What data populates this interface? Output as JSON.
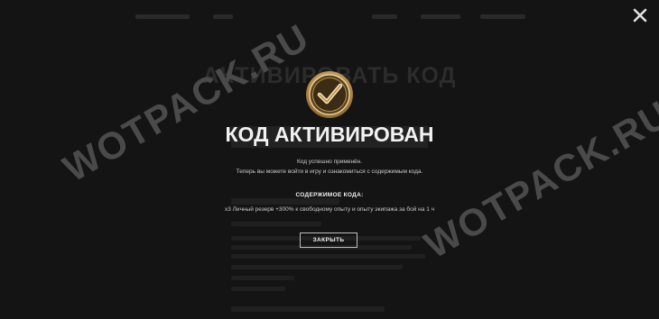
{
  "background_page": {
    "title": "АКТИВИРОВАТЬ КОД"
  },
  "watermarks": [
    "WOTPACK.RU",
    "WOTPACK.RU",
    "WOTPACK.RU"
  ],
  "modal": {
    "title": "КОД АКТИВИРОВАН",
    "line1": "Код успешно применён.",
    "line2": "Теперь вы можете войти в игру и ознакомиться с содержимым кода.",
    "content_label": "СОДЕРЖИМОЕ КОДА:",
    "content_value": "x3 Личный резерв +300% к свободному опыту и опыту экипажа за бой на 1 ч",
    "close_button": "ЗАКРЫТЬ"
  },
  "icons": {
    "close": "close-icon",
    "emblem": "checkmark-emblem-icon"
  },
  "colors": {
    "background": "#141414",
    "gold": "#c9a25a"
  }
}
